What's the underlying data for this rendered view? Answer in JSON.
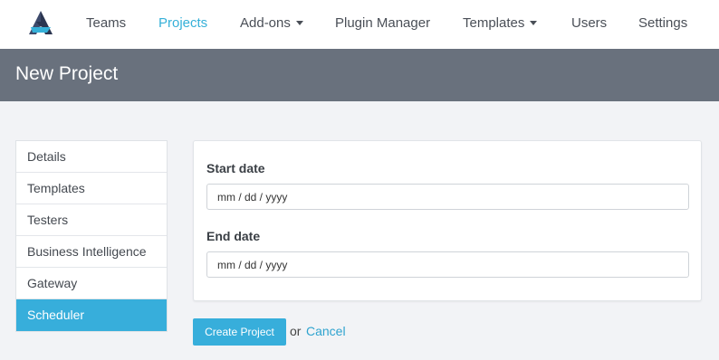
{
  "nav": {
    "items": [
      {
        "label": "Teams",
        "active": false,
        "has_dropdown": false
      },
      {
        "label": "Projects",
        "active": true,
        "has_dropdown": false
      },
      {
        "label": "Add-ons",
        "active": false,
        "has_dropdown": true
      },
      {
        "label": "Plugin Manager",
        "active": false,
        "has_dropdown": false
      },
      {
        "label": "Templates",
        "active": false,
        "has_dropdown": true
      },
      {
        "label": "Users",
        "active": false,
        "has_dropdown": false
      },
      {
        "label": "Settings",
        "active": false,
        "has_dropdown": false
      }
    ],
    "logo_icon": "app-logo-icon"
  },
  "header": {
    "title": "New Project"
  },
  "sidebar": {
    "items": [
      {
        "label": "Details",
        "active": false
      },
      {
        "label": "Templates",
        "active": false
      },
      {
        "label": "Testers",
        "active": false
      },
      {
        "label": "Business Intelligence",
        "active": false
      },
      {
        "label": "Gateway",
        "active": false
      },
      {
        "label": "Scheduler",
        "active": true
      }
    ]
  },
  "form": {
    "start_date": {
      "label": "Start date",
      "placeholder": "mm / dd / yyyy",
      "value": ""
    },
    "end_date": {
      "label": "End date",
      "placeholder": "mm / dd / yyyy",
      "value": ""
    }
  },
  "actions": {
    "create_label": "Create Project",
    "or_text": "or",
    "cancel_label": "Cancel"
  },
  "colors": {
    "accent": "#37aedb",
    "header_bar": "#69717d",
    "background": "#f2f3f6"
  }
}
